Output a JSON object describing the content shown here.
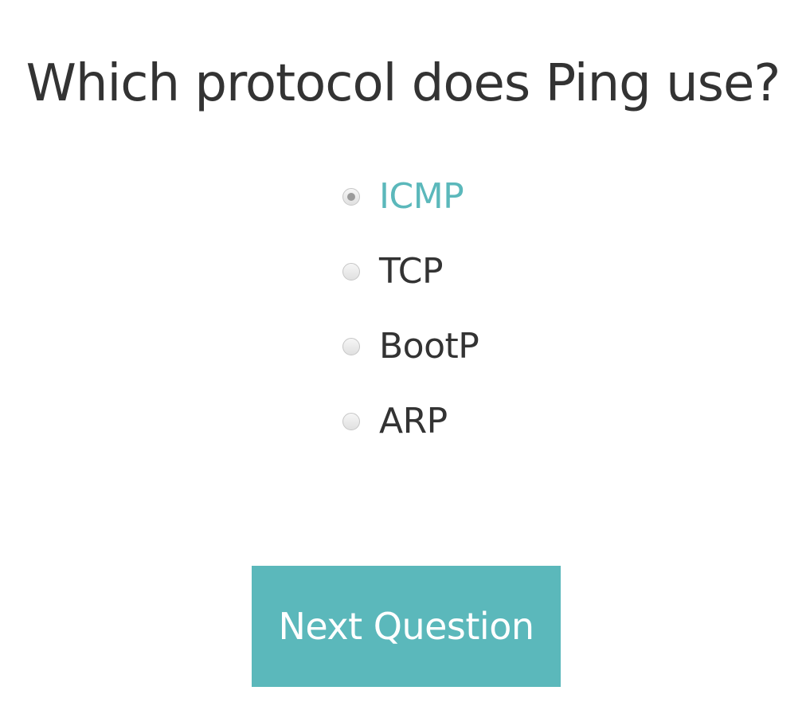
{
  "quiz": {
    "question": "Which protocol does Ping use?",
    "options": [
      {
        "label": "ICMP",
        "selected": true
      },
      {
        "label": "TCP",
        "selected": false
      },
      {
        "label": "BootP",
        "selected": false
      },
      {
        "label": "ARP",
        "selected": false
      }
    ],
    "next_label": "Next Question"
  },
  "colors": {
    "accent": "#5bb8bb",
    "text": "#333333",
    "button_text": "#ffffff"
  }
}
